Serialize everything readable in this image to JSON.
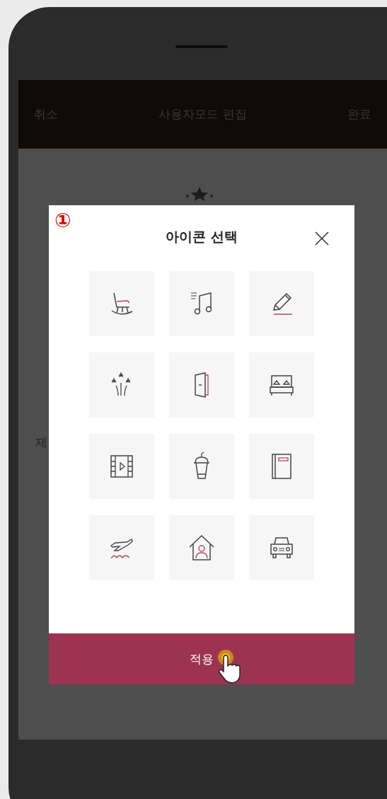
{
  "step_marker": "①",
  "app_header": {
    "left": "취소",
    "title": "사용자모드 편집",
    "right": "완료"
  },
  "background_label": "제",
  "dialog": {
    "title": "아이콘 선택",
    "icons": [
      {
        "kind": "rocking-chair"
      },
      {
        "kind": "music"
      },
      {
        "kind": "pencil"
      },
      {
        "kind": "fireworks"
      },
      {
        "kind": "door"
      },
      {
        "kind": "bed"
      },
      {
        "kind": "film"
      },
      {
        "kind": "drink"
      },
      {
        "kind": "book"
      },
      {
        "kind": "airplane"
      },
      {
        "kind": "home"
      },
      {
        "kind": "car"
      }
    ],
    "apply_button": "적용"
  }
}
